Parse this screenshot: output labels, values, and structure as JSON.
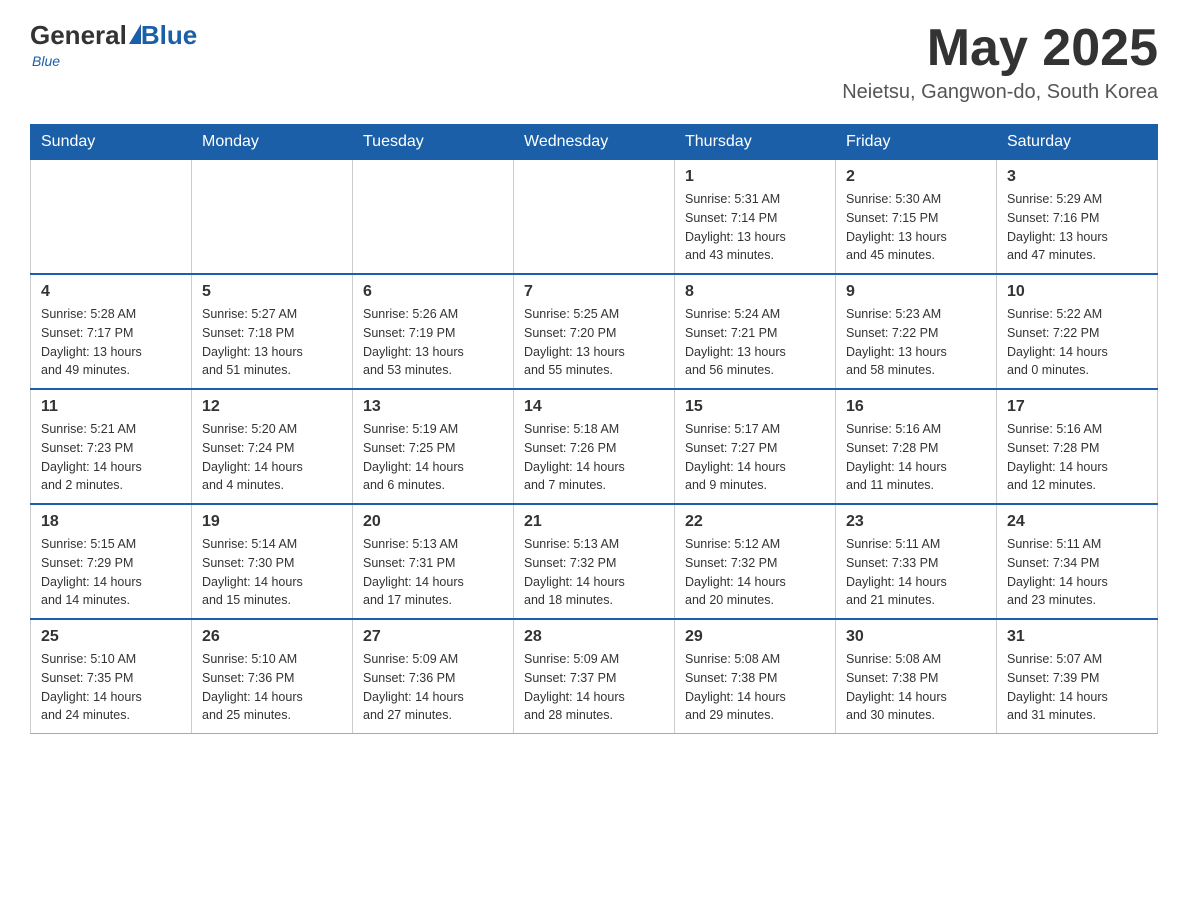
{
  "header": {
    "logo": {
      "general": "General",
      "blue": "Blue",
      "tagline": "Blue"
    },
    "title": "May 2025",
    "location": "Neietsu, Gangwon-do, South Korea"
  },
  "calendar": {
    "days_of_week": [
      "Sunday",
      "Monday",
      "Tuesday",
      "Wednesday",
      "Thursday",
      "Friday",
      "Saturday"
    ],
    "weeks": [
      {
        "days": [
          {
            "number": "",
            "info": ""
          },
          {
            "number": "",
            "info": ""
          },
          {
            "number": "",
            "info": ""
          },
          {
            "number": "",
            "info": ""
          },
          {
            "number": "1",
            "info": "Sunrise: 5:31 AM\nSunset: 7:14 PM\nDaylight: 13 hours\nand 43 minutes."
          },
          {
            "number": "2",
            "info": "Sunrise: 5:30 AM\nSunset: 7:15 PM\nDaylight: 13 hours\nand 45 minutes."
          },
          {
            "number": "3",
            "info": "Sunrise: 5:29 AM\nSunset: 7:16 PM\nDaylight: 13 hours\nand 47 minutes."
          }
        ]
      },
      {
        "days": [
          {
            "number": "4",
            "info": "Sunrise: 5:28 AM\nSunset: 7:17 PM\nDaylight: 13 hours\nand 49 minutes."
          },
          {
            "number": "5",
            "info": "Sunrise: 5:27 AM\nSunset: 7:18 PM\nDaylight: 13 hours\nand 51 minutes."
          },
          {
            "number": "6",
            "info": "Sunrise: 5:26 AM\nSunset: 7:19 PM\nDaylight: 13 hours\nand 53 minutes."
          },
          {
            "number": "7",
            "info": "Sunrise: 5:25 AM\nSunset: 7:20 PM\nDaylight: 13 hours\nand 55 minutes."
          },
          {
            "number": "8",
            "info": "Sunrise: 5:24 AM\nSunset: 7:21 PM\nDaylight: 13 hours\nand 56 minutes."
          },
          {
            "number": "9",
            "info": "Sunrise: 5:23 AM\nSunset: 7:22 PM\nDaylight: 13 hours\nand 58 minutes."
          },
          {
            "number": "10",
            "info": "Sunrise: 5:22 AM\nSunset: 7:22 PM\nDaylight: 14 hours\nand 0 minutes."
          }
        ]
      },
      {
        "days": [
          {
            "number": "11",
            "info": "Sunrise: 5:21 AM\nSunset: 7:23 PM\nDaylight: 14 hours\nand 2 minutes."
          },
          {
            "number": "12",
            "info": "Sunrise: 5:20 AM\nSunset: 7:24 PM\nDaylight: 14 hours\nand 4 minutes."
          },
          {
            "number": "13",
            "info": "Sunrise: 5:19 AM\nSunset: 7:25 PM\nDaylight: 14 hours\nand 6 minutes."
          },
          {
            "number": "14",
            "info": "Sunrise: 5:18 AM\nSunset: 7:26 PM\nDaylight: 14 hours\nand 7 minutes."
          },
          {
            "number": "15",
            "info": "Sunrise: 5:17 AM\nSunset: 7:27 PM\nDaylight: 14 hours\nand 9 minutes."
          },
          {
            "number": "16",
            "info": "Sunrise: 5:16 AM\nSunset: 7:28 PM\nDaylight: 14 hours\nand 11 minutes."
          },
          {
            "number": "17",
            "info": "Sunrise: 5:16 AM\nSunset: 7:28 PM\nDaylight: 14 hours\nand 12 minutes."
          }
        ]
      },
      {
        "days": [
          {
            "number": "18",
            "info": "Sunrise: 5:15 AM\nSunset: 7:29 PM\nDaylight: 14 hours\nand 14 minutes."
          },
          {
            "number": "19",
            "info": "Sunrise: 5:14 AM\nSunset: 7:30 PM\nDaylight: 14 hours\nand 15 minutes."
          },
          {
            "number": "20",
            "info": "Sunrise: 5:13 AM\nSunset: 7:31 PM\nDaylight: 14 hours\nand 17 minutes."
          },
          {
            "number": "21",
            "info": "Sunrise: 5:13 AM\nSunset: 7:32 PM\nDaylight: 14 hours\nand 18 minutes."
          },
          {
            "number": "22",
            "info": "Sunrise: 5:12 AM\nSunset: 7:32 PM\nDaylight: 14 hours\nand 20 minutes."
          },
          {
            "number": "23",
            "info": "Sunrise: 5:11 AM\nSunset: 7:33 PM\nDaylight: 14 hours\nand 21 minutes."
          },
          {
            "number": "24",
            "info": "Sunrise: 5:11 AM\nSunset: 7:34 PM\nDaylight: 14 hours\nand 23 minutes."
          }
        ]
      },
      {
        "days": [
          {
            "number": "25",
            "info": "Sunrise: 5:10 AM\nSunset: 7:35 PM\nDaylight: 14 hours\nand 24 minutes."
          },
          {
            "number": "26",
            "info": "Sunrise: 5:10 AM\nSunset: 7:36 PM\nDaylight: 14 hours\nand 25 minutes."
          },
          {
            "number": "27",
            "info": "Sunrise: 5:09 AM\nSunset: 7:36 PM\nDaylight: 14 hours\nand 27 minutes."
          },
          {
            "number": "28",
            "info": "Sunrise: 5:09 AM\nSunset: 7:37 PM\nDaylight: 14 hours\nand 28 minutes."
          },
          {
            "number": "29",
            "info": "Sunrise: 5:08 AM\nSunset: 7:38 PM\nDaylight: 14 hours\nand 29 minutes."
          },
          {
            "number": "30",
            "info": "Sunrise: 5:08 AM\nSunset: 7:38 PM\nDaylight: 14 hours\nand 30 minutes."
          },
          {
            "number": "31",
            "info": "Sunrise: 5:07 AM\nSunset: 7:39 PM\nDaylight: 14 hours\nand 31 minutes."
          }
        ]
      }
    ]
  }
}
